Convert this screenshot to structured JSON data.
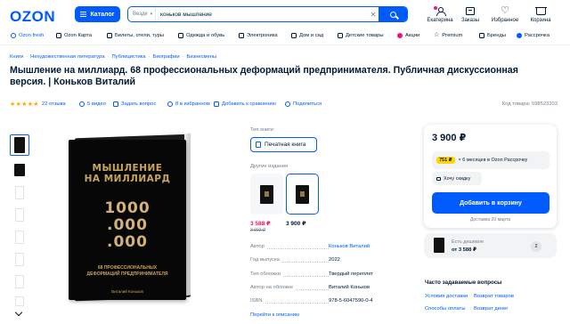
{
  "header": {
    "logo": "OZON",
    "catalog_label": "Каталог",
    "search_scope": "Везде",
    "search_query": "коньков мышление",
    "items": [
      {
        "label": "Екатерина",
        "icon": "user-icon"
      },
      {
        "label": "Заказы",
        "icon": "box-icon"
      },
      {
        "label": "Избранное",
        "icon": "heart-icon"
      },
      {
        "label": "Корзина",
        "icon": "cart-icon"
      }
    ]
  },
  "nav": [
    "Ozon fresh",
    "Ozon Карта",
    "Билеты, отели, туры",
    "Одежда и обувь",
    "Электроника",
    "Дом и сад",
    "Детские товары",
    "Акции",
    "Premium",
    "Бренды",
    "Рассрочка"
  ],
  "breadcrumb": [
    "Книги",
    "Нехудожественная литература",
    "Публицистика",
    "Биографии",
    "Бизнесмены"
  ],
  "product": {
    "title": "Мышление на миллиард. 68 профессиональных деформаций предпринимателя. Публичная дискуссионная версия. | Коньков Виталий",
    "stars": "★★★★★",
    "reviews": "22 отзыва",
    "videos": "5 видео",
    "ask": "Задать вопрос",
    "favorites": "8 в избранном",
    "compare": "Добавить к сравнению",
    "share": "Поделиться",
    "code": "Код товара: 598523203"
  },
  "book_cover": {
    "title_line1": "МЫШЛЕНИЕ",
    "title_line2": "НА МИЛЛИАРД",
    "num_line1": "1000",
    "num_line2": ".000",
    "num_line3": ".000",
    "subtitle_line1": "68 ПРОФЕССИОНАЛЬНЫХ",
    "subtitle_line2": "ДЕФОРМАЦИЙ ПРЕДПРИНИМАТЕЛЯ",
    "author": "Виталий Коньков"
  },
  "specs_panel": {
    "type_label": "Тип книги:",
    "type_value": "Печатная книга",
    "editions_label": "Другие издания",
    "editions": [
      {
        "price": "3 588 ₽",
        "old_price": "3 992 ₽"
      },
      {
        "price": "3 900 ₽"
      }
    ],
    "rows": [
      {
        "key": "Автор",
        "value": "Коньков Виталий",
        "link": true
      },
      {
        "key": "Год выпуска",
        "value": "2022",
        "link": false
      },
      {
        "key": "Тип обложки",
        "value": "Твердый переплет",
        "link": false
      },
      {
        "key": "Автор на обложке",
        "value": "Виталий Коньков",
        "link": false
      },
      {
        "key": "ISBN",
        "value": "978-5-6047590-0-4",
        "link": false
      }
    ],
    "more_link": "Перейти к описанию"
  },
  "buy_box": {
    "price": "3 900 ₽",
    "installment_badge": "751 ₽",
    "installment_text": "× 6 месяцев в Ozon Рассрочку",
    "discount_label": "Хочу скидку",
    "add_to_cart": "Добавить в корзину",
    "delivery": "Доставка 20 марта"
  },
  "cheaper": {
    "title": "Есть дешевле",
    "price": "от 3 588 ₽",
    "count": "2"
  },
  "faq": {
    "title": "Часто задаваемые вопросы",
    "links": [
      "Условия доставки",
      "Возврат товаров",
      "Способы оплаты",
      "Возврат денег"
    ]
  },
  "colors": {
    "brand": "#005bff",
    "text": "#001a34",
    "muted": "#707f8d",
    "sale": "#f91155",
    "star": "#ffa800",
    "installment": "#ffd600"
  }
}
